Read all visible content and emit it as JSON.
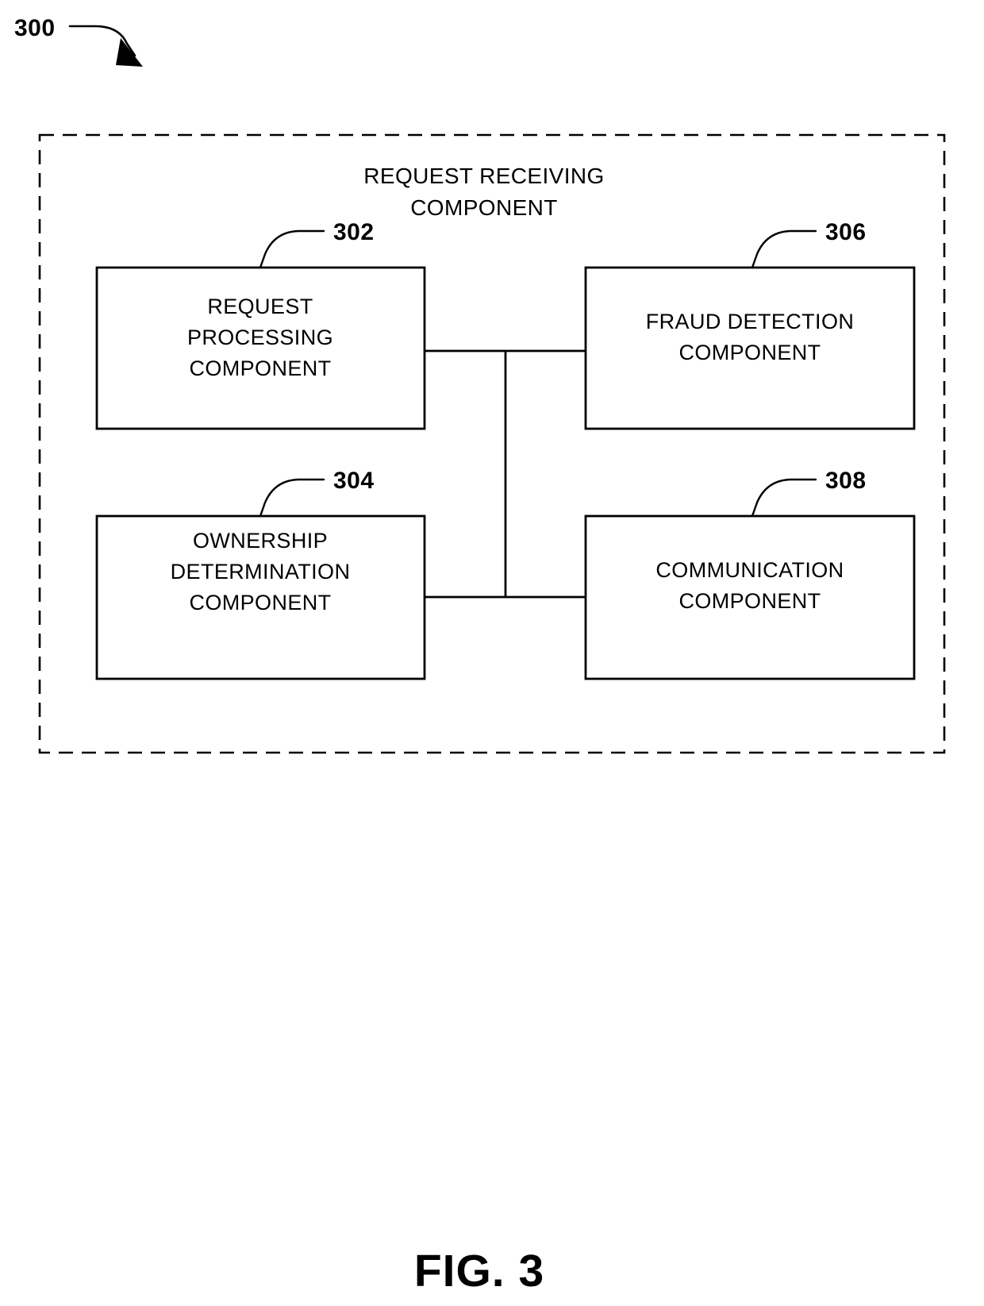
{
  "figure": {
    "figure_number": "300",
    "caption": "FIG. 3",
    "container": {
      "title_line1": "REQUEST RECEIVING",
      "title_line2": "COMPONENT",
      "border_style": "dashed"
    },
    "blocks": [
      {
        "ref": "302",
        "name": "request-processing-component",
        "lines": [
          "REQUEST",
          "PROCESSING",
          "COMPONENT"
        ]
      },
      {
        "ref": "306",
        "name": "fraud-detection-component",
        "lines": [
          "FRAUD DETECTION",
          "COMPONENT"
        ]
      },
      {
        "ref": "304",
        "name": "ownership-determination-component",
        "lines": [
          "OWNERSHIP",
          "DETERMINATION",
          "COMPONENT"
        ]
      },
      {
        "ref": "308",
        "name": "communication-component",
        "lines": [
          "COMMUNICATION",
          "COMPONENT"
        ]
      }
    ],
    "colors": {
      "line": "#000000",
      "background": "#ffffff",
      "text": "#000000"
    }
  },
  "chart_data": {
    "type": "diagram",
    "title": "FIG. 3",
    "diagram_label": "300",
    "container_label": "REQUEST RECEIVING COMPONENT",
    "nodes": [
      {
        "id": "302",
        "label": "REQUEST PROCESSING COMPONENT",
        "position": "top-left"
      },
      {
        "id": "306",
        "label": "FRAUD DETECTION COMPONENT",
        "position": "top-right"
      },
      {
        "id": "304",
        "label": "OWNERSHIP DETERMINATION COMPONENT",
        "position": "bottom-left"
      },
      {
        "id": "308",
        "label": "COMMUNICATION COMPONENT",
        "position": "bottom-right"
      }
    ],
    "edges": [
      {
        "from": "302",
        "to": "306",
        "style": "solid"
      },
      {
        "from": "304",
        "to": "308",
        "style": "solid"
      },
      {
        "from": "bus-top",
        "to": "bus-bottom",
        "style": "solid"
      }
    ]
  }
}
